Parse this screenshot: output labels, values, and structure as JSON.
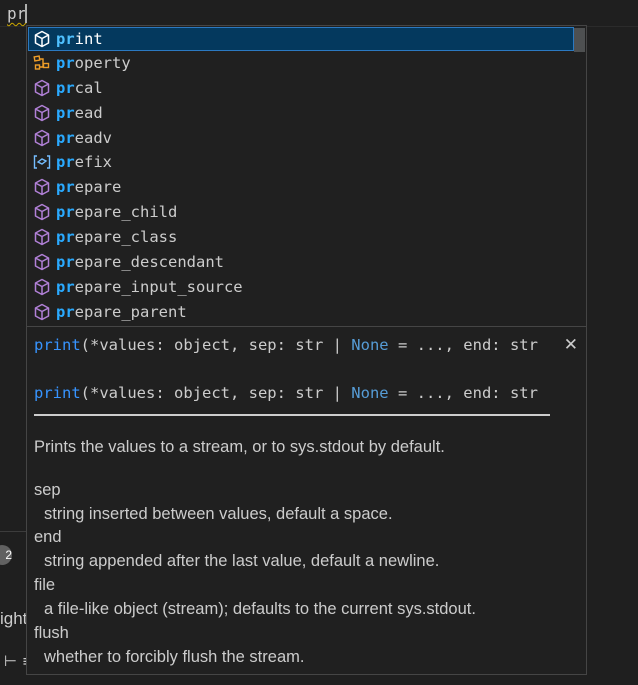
{
  "editor": {
    "typed_text": "pr"
  },
  "background": {
    "badge": "2",
    "partial_text": "ight",
    "partial_glyph": "⊢ ≡"
  },
  "suggestions": {
    "match": "pr",
    "items": [
      {
        "prefix": "pr",
        "rest": "int",
        "icon": "method-icon",
        "selected": true
      },
      {
        "prefix": "pr",
        "rest": "operty",
        "icon": "class-icon",
        "selected": false
      },
      {
        "prefix": "pr",
        "rest": "cal",
        "icon": "method-icon",
        "selected": false
      },
      {
        "prefix": "pr",
        "rest": "ead",
        "icon": "method-icon",
        "selected": false
      },
      {
        "prefix": "pr",
        "rest": "eadv",
        "icon": "method-icon",
        "selected": false
      },
      {
        "prefix": "pr",
        "rest": "efix",
        "icon": "variable-icon",
        "selected": false
      },
      {
        "prefix": "pr",
        "rest": "epare",
        "icon": "method-icon",
        "selected": false
      },
      {
        "prefix": "pr",
        "rest": "epare_child",
        "icon": "method-icon",
        "selected": false
      },
      {
        "prefix": "pr",
        "rest": "epare_class",
        "icon": "method-icon",
        "selected": false
      },
      {
        "prefix": "pr",
        "rest": "epare_descendant",
        "icon": "method-icon",
        "selected": false
      },
      {
        "prefix": "pr",
        "rest": "epare_input_source",
        "icon": "method-icon",
        "selected": false
      },
      {
        "prefix": "pr",
        "rest": "epare_parent",
        "icon": "method-icon",
        "selected": false
      }
    ]
  },
  "details": {
    "signature_header": {
      "fn": "print",
      "before_none": "(*values: object, sep: str | ",
      "none": "None",
      "after_none": " = ..., end: str"
    },
    "signature_code": {
      "fn": "print",
      "before_none": "(*values: object, sep: str | ",
      "none": "None",
      "after_none": " = ..., end: str"
    },
    "summary": "Prints the values to a stream, or to sys.stdout by default.",
    "params": [
      {
        "name": "sep",
        "desc": "string inserted between values, default a space."
      },
      {
        "name": "end",
        "desc": "string appended after the last value, default a newline."
      },
      {
        "name": "file",
        "desc": "a file-like object (stream); defaults to the current sys.stdout."
      },
      {
        "name": "flush",
        "desc": "whether to forcibly flush the stream."
      }
    ]
  },
  "colors": {
    "match_highlight": "#2aaaff",
    "selected_background": "#04395e",
    "method_icon": "#b180d7",
    "class_icon": "#ee9d28",
    "variable_icon": "#75beff"
  }
}
